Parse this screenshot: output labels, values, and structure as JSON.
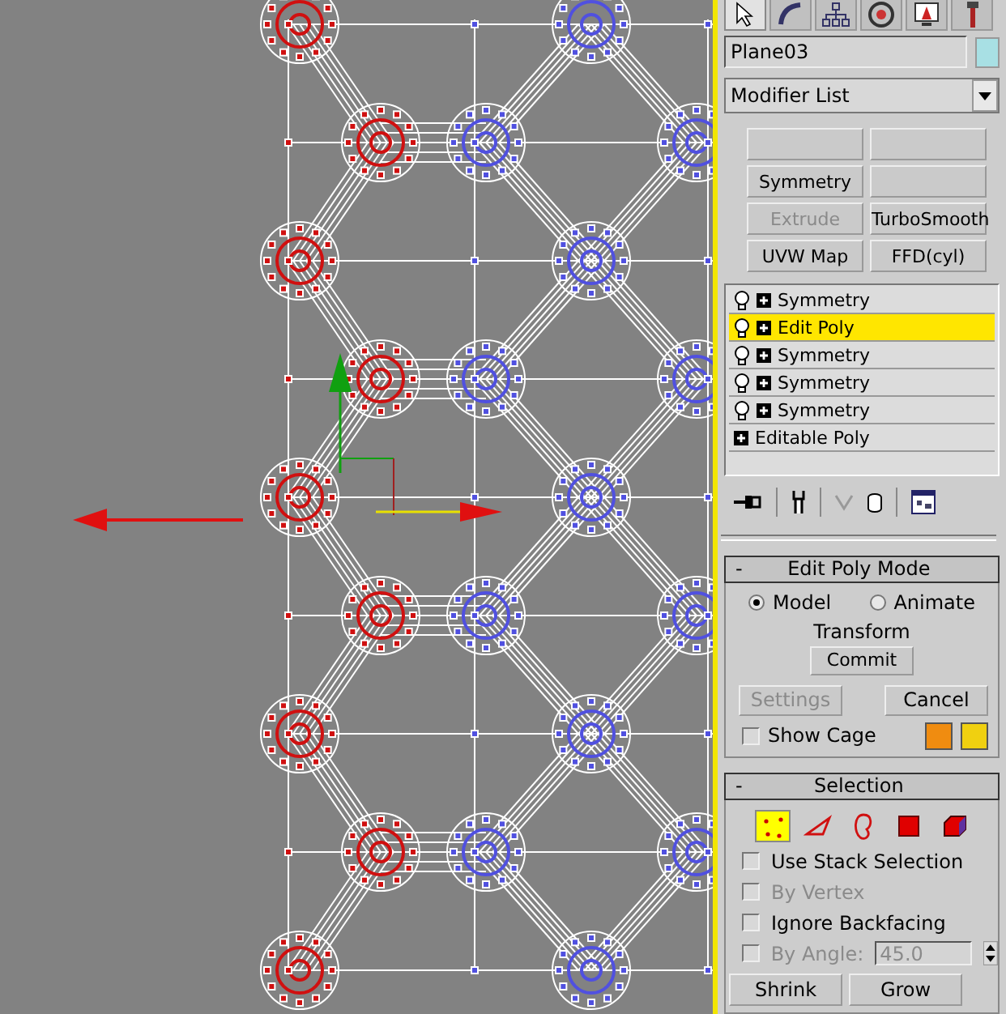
{
  "command_tabs": [
    {
      "selected": true
    },
    {
      "selected": false
    },
    {
      "selected": false
    },
    {
      "selected": false
    },
    {
      "selected": false
    },
    {
      "selected": false
    }
  ],
  "object_name": {
    "value": "Plane03",
    "color": "#a8e0e4"
  },
  "modifier_list": {
    "value": "Modifier List"
  },
  "modifier_buttons": [
    {
      "kind": "blank"
    },
    {
      "kind": "blank"
    },
    {
      "kind": "labeled",
      "label": "Symmetry",
      "disabled": false
    },
    {
      "kind": "blank"
    },
    {
      "kind": "labeled",
      "label": "Extrude",
      "disabled": true
    },
    {
      "kind": "labeled",
      "label": "TurboSmooth",
      "disabled": false
    },
    {
      "kind": "labeled",
      "label": "UVW Map",
      "disabled": false
    },
    {
      "kind": "labeled",
      "label": "FFD(cyl)",
      "disabled": false
    }
  ],
  "modifier_stack": [
    {
      "label": "Symmetry",
      "kind": "modifier",
      "selected": false
    },
    {
      "label": "Edit Poly",
      "kind": "modifier",
      "selected": true
    },
    {
      "label": "Symmetry",
      "kind": "modifier",
      "selected": false
    },
    {
      "label": "Symmetry",
      "kind": "modifier",
      "selected": false
    },
    {
      "label": "Symmetry",
      "kind": "modifier",
      "selected": false
    },
    {
      "label": "Editable Poly",
      "kind": "base",
      "selected": false
    }
  ],
  "edit_poly_mode": {
    "collapse": "-",
    "title": "Edit Poly Mode",
    "modes": [
      {
        "label": "Model",
        "selected": true
      },
      {
        "label": "Animate",
        "selected": false
      }
    ],
    "transform_label": "Transform",
    "commit": "Commit",
    "settings": {
      "label": "Settings",
      "disabled": true
    },
    "cancel": {
      "label": "Cancel",
      "disabled": false
    },
    "show_cage": {
      "label": "Show Cage",
      "checked": false
    },
    "cage_colors": [
      {
        "color": "#f08c10"
      },
      {
        "color": "#f0d010"
      }
    ]
  },
  "selection": {
    "collapse": "-",
    "title": "Selection",
    "subobjects": [
      {
        "kind": "vertex",
        "selected": true
      },
      {
        "kind": "edge",
        "selected": false
      },
      {
        "kind": "border",
        "selected": false
      },
      {
        "kind": "polygon",
        "selected": false
      },
      {
        "kind": "element",
        "selected": false
      }
    ],
    "options": [
      {
        "label": "Use Stack Selection",
        "checked": false,
        "disabled": false
      },
      {
        "label": "By Vertex",
        "checked": false,
        "disabled": true
      },
      {
        "label": "Ignore Backfacing",
        "checked": false,
        "disabled": false
      },
      {
        "label": "By Angle:",
        "checked": false,
        "disabled": true,
        "value": "45.0"
      }
    ],
    "buttons": [
      "Shrink",
      "Grow"
    ]
  }
}
